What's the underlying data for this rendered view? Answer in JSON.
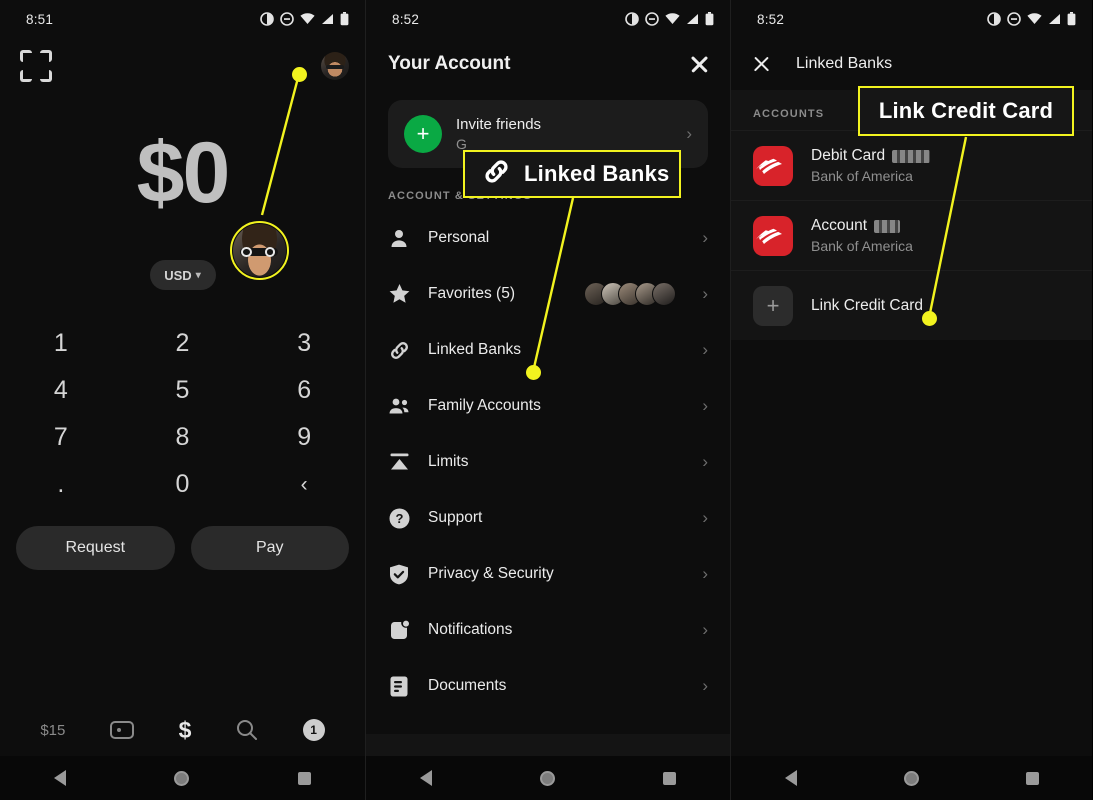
{
  "screen1": {
    "statusbar": {
      "time": "8:51",
      "icons": [
        "contrast-icon",
        "dnd-icon",
        "wifi-icon",
        "signal-icon",
        "battery-icon"
      ]
    },
    "scan_icon": "scan-frame-icon",
    "avatar": "profile-avatar",
    "amount": "$0",
    "currency": "USD",
    "keypad": [
      "1",
      "2",
      "3",
      "4",
      "5",
      "6",
      "7",
      "8",
      "9",
      ".",
      "0",
      "‹"
    ],
    "actions": {
      "request": "Request",
      "pay": "Pay"
    },
    "tabbar": {
      "money": "$15",
      "card_icon": "card-icon",
      "dollar": "$",
      "search_icon": "search-icon",
      "badge": "1"
    }
  },
  "screen2": {
    "statusbar": {
      "time": "8:52"
    },
    "title": "Your Account",
    "close_label": "close-icon",
    "invite": {
      "title": "Invite friends",
      "subtitle": "G",
      "plus": "+"
    },
    "section_label": "ACCOUNT & SETTINGS",
    "menu": [
      {
        "label": "Personal",
        "icon": "person-icon"
      },
      {
        "label": "Favorites (5)",
        "icon": "star-icon",
        "avatars": 5
      },
      {
        "label": "Linked Banks",
        "icon": "link-icon"
      },
      {
        "label": "Family Accounts",
        "icon": "family-icon"
      },
      {
        "label": "Limits",
        "icon": "limits-icon"
      },
      {
        "label": "Support",
        "icon": "question-icon"
      },
      {
        "label": "Privacy & Security",
        "icon": "shield-check-icon"
      },
      {
        "label": "Notifications",
        "icon": "notification-icon"
      },
      {
        "label": "Documents",
        "icon": "document-icon"
      }
    ]
  },
  "screen3": {
    "statusbar": {
      "time": "8:52"
    },
    "title": "Linked Banks",
    "section_label": "ACCOUNTS",
    "rows": [
      {
        "title": "Debit Card",
        "redacted": true,
        "subtitle": "Bank of America",
        "icon": "bank-of-america-icon"
      },
      {
        "title": "Account",
        "redacted": true,
        "subtitle": "Bank of America",
        "icon": "bank-of-america-icon"
      },
      {
        "title": "Link Credit Card",
        "redacted": false,
        "subtitle": "",
        "icon": "plus-icon"
      }
    ]
  },
  "annotations": [
    {
      "id": "linked-banks-callout",
      "text": "Linked Banks",
      "icon": "link-icon",
      "accent": "#f2f31f"
    },
    {
      "id": "link-credit-card-callout",
      "text": "Link Credit Card",
      "accent": "#f2f31f"
    }
  ],
  "colors": {
    "accent": "#f2f31f",
    "bg": "#0d0d0d",
    "green": "#0aa944",
    "boa_red": "#d8232a"
  },
  "navbar": {
    "back": "back-icon",
    "home": "home-icon",
    "recents": "recents-icon"
  }
}
